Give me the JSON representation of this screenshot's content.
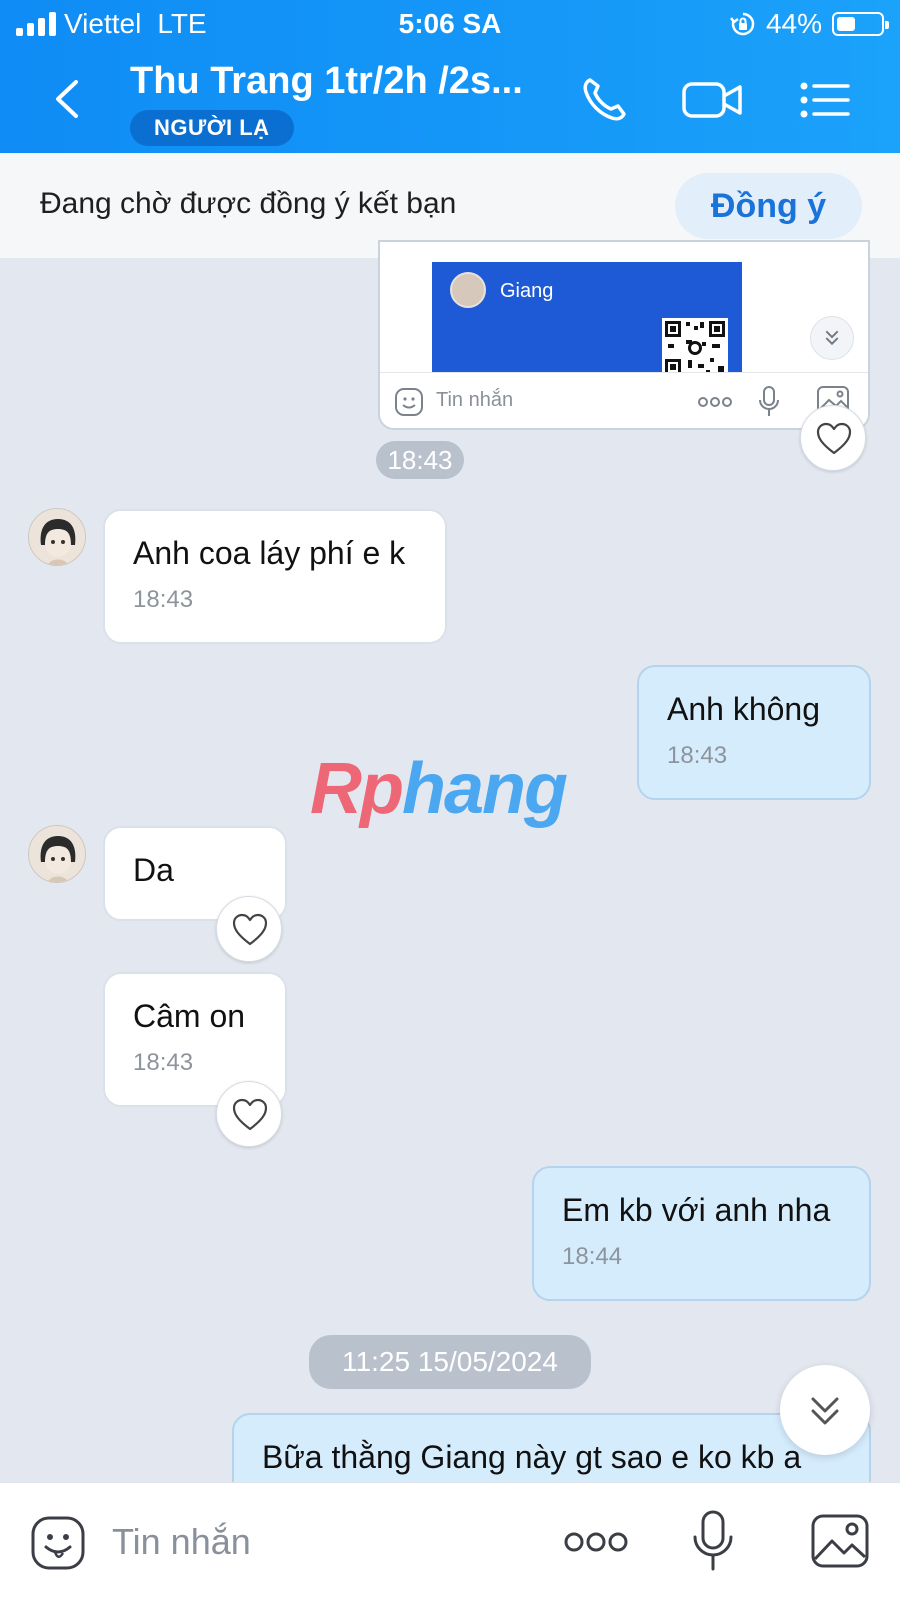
{
  "status_bar": {
    "carrier": "Viettel",
    "network": "LTE",
    "time": "5:06 SA",
    "battery_percent": "44%",
    "battery_level": 0.44
  },
  "header": {
    "title": "Thu Trang 1tr/2h /2s...",
    "badge": "NGƯỜI LẠ"
  },
  "friend_request": {
    "text": "Đang chờ được đồng ý kết bạn",
    "accept_label": "Đồng ý"
  },
  "shared_card": {
    "name": "Giang",
    "input_placeholder": "Tin nhắn"
  },
  "time_separators": [
    "18:43",
    "11:25 15/05/2024"
  ],
  "messages": [
    {
      "dir": "in",
      "text": "Anh coa láy phí e k",
      "time": "18:43"
    },
    {
      "dir": "out",
      "text": "Anh không",
      "time": "18:43"
    },
    {
      "dir": "in",
      "text": "Da",
      "time": ""
    },
    {
      "dir": "in",
      "text": "Câm on",
      "time": "18:43"
    },
    {
      "dir": "out",
      "text": "Em kb với anh nha",
      "time": "18:44"
    },
    {
      "dir": "out",
      "text": "Bữa thằng Giang này gt sao e ko kb a",
      "time": ""
    }
  ],
  "watermark": {
    "part1": "Rp",
    "part2": "hang"
  },
  "input_bar": {
    "placeholder": "Tin nhắn"
  },
  "colors": {
    "header": "#1598f8",
    "outgoing_bubble": "#d5ecfd",
    "incoming_bubble": "#ffffff",
    "accent": "#1a73d8"
  }
}
